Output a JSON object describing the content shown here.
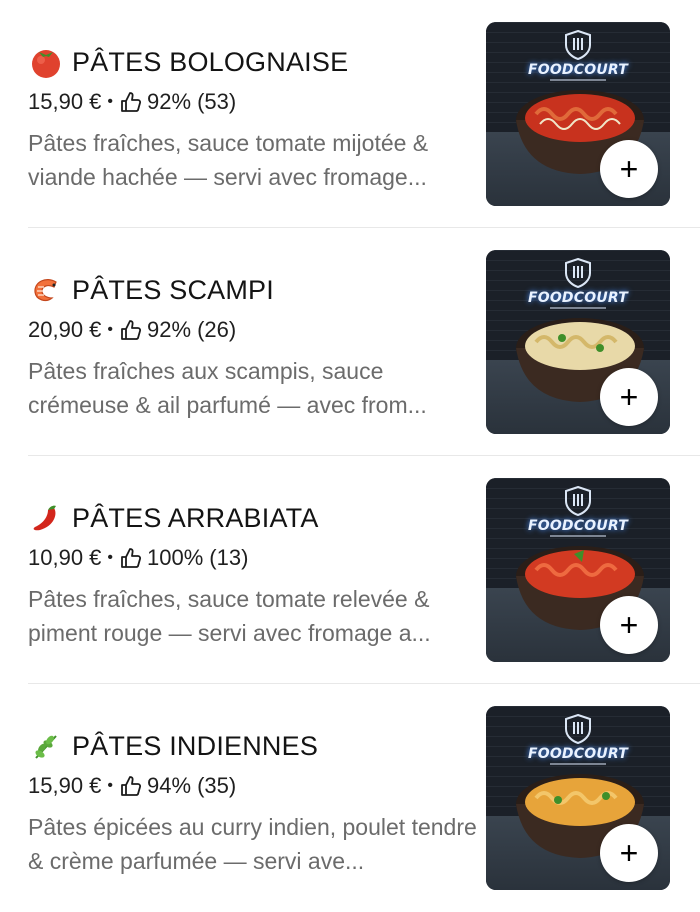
{
  "items": [
    {
      "emoji": "tomato-icon",
      "title": "PÂTES BOLOGNAISE",
      "price": "15,90 €",
      "separator": "•",
      "rating": "92%",
      "reviews": "(53)",
      "description": "Pâtes fraîches, sauce tomate mijotée & viande hachée — servi avec fromage...",
      "photo_brand": "FOODCOURT",
      "add_label": "+"
    },
    {
      "emoji": "shrimp-icon",
      "title": "PÂTES SCAMPI",
      "price": "20,90 €",
      "separator": "•",
      "rating": "92%",
      "reviews": "(26)",
      "description": "Pâtes fraîches aux scampis, sauce crémeuse & ail parfumé — avec from...",
      "photo_brand": "FOODCOURT",
      "add_label": "+"
    },
    {
      "emoji": "chili-pepper-icon",
      "title": "PÂTES ARRABIATA",
      "price": "10,90 €",
      "separator": "•",
      "rating": "100%",
      "reviews": "(13)",
      "description": "Pâtes fraîches, sauce tomate relevée & piment rouge — servi avec fromage a...",
      "photo_brand": "FOODCOURT",
      "add_label": "+"
    },
    {
      "emoji": "herb-icon",
      "title": "PÂTES INDIENNES",
      "price": "15,90 €",
      "separator": "•",
      "rating": "94%",
      "reviews": "(35)",
      "description": "Pâtes épicées au curry indien, poulet tendre & crème parfumée — servi ave...",
      "photo_brand": "FOODCOURT",
      "add_label": "+"
    }
  ],
  "colors": {
    "text": "#141414",
    "description": "#6b6b6b",
    "divider": "#e8e8e8",
    "sauce_bolognaise": "#c8321e",
    "sauce_scampi": "#e8d9a8",
    "sauce_arrabiata": "#d23a22",
    "sauce_indiennes": "#e7a43a"
  }
}
